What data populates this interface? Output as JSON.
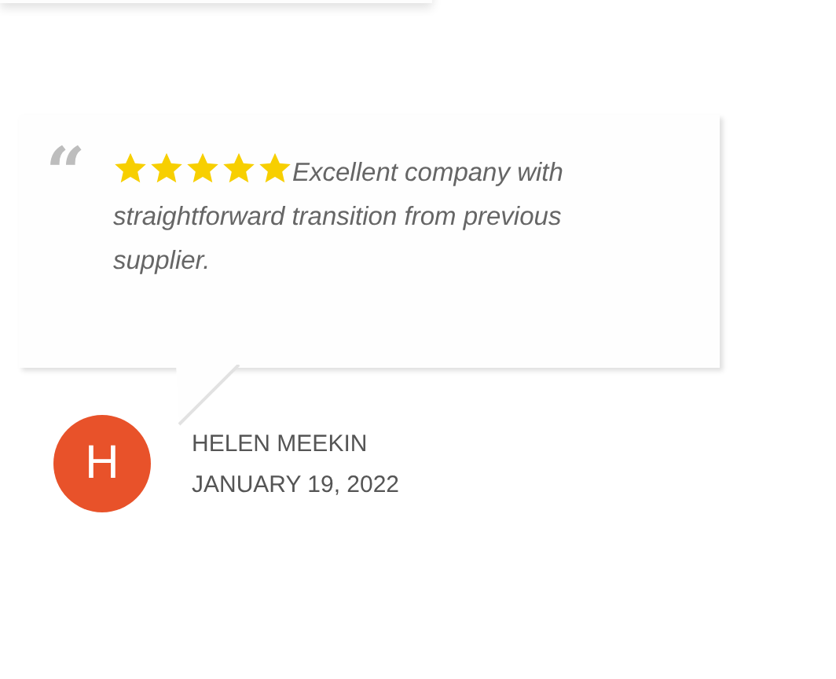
{
  "review": {
    "quote_mark": "“",
    "stars": 5,
    "text": "Excellent company with straightforward transition from previous supplier."
  },
  "author": {
    "initial": "H",
    "name": "HELEN MEEKIN",
    "date": "JANUARY 19, 2022"
  }
}
